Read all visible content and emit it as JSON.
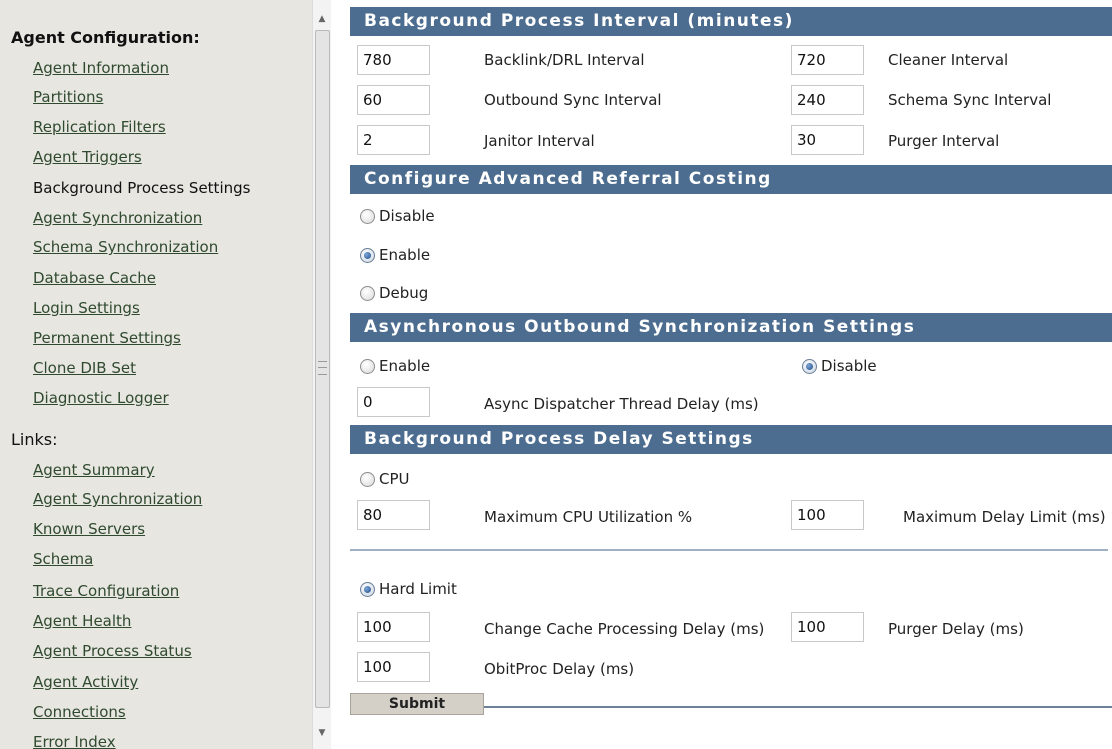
{
  "sidebar": {
    "config_heading": "Agent Configuration:",
    "config_items": [
      {
        "label": "Agent Information"
      },
      {
        "label": "Partitions"
      },
      {
        "label": "Replication Filters"
      },
      {
        "label": "Agent Triggers"
      },
      {
        "label": "Background Process Settings",
        "active": true
      },
      {
        "label": "Agent Synchronization"
      },
      {
        "label": "Schema Synchronization"
      },
      {
        "label": "Database Cache"
      },
      {
        "label": "Login Settings"
      },
      {
        "label": "Permanent Settings"
      },
      {
        "label": "Clone DIB Set"
      },
      {
        "label": "Diagnostic Logger"
      }
    ],
    "links_heading": "Links:",
    "link_items": [
      {
        "label": "Agent Summary"
      },
      {
        "label": "Agent Synchronization"
      },
      {
        "label": "Known Servers"
      },
      {
        "label": "Schema"
      },
      {
        "label": "Trace Configuration"
      },
      {
        "label": "Agent Health"
      },
      {
        "label": "Agent Process Status"
      },
      {
        "label": "Agent Activity"
      },
      {
        "label": "Connections"
      },
      {
        "label": "Error Index"
      }
    ]
  },
  "intervals": {
    "title": "Background Process Interval (minutes)",
    "backlink": {
      "value": "780",
      "label": "Backlink/DRL Interval"
    },
    "cleaner": {
      "value": "720",
      "label": "Cleaner Interval"
    },
    "outbound": {
      "value": "60",
      "label": "Outbound Sync Interval"
    },
    "schema": {
      "value": "240",
      "label": "Schema Sync Interval"
    },
    "janitor": {
      "value": "2",
      "label": "Janitor Interval"
    },
    "purger": {
      "value": "30",
      "label": "Purger Interval"
    }
  },
  "referral": {
    "title": "Configure Advanced Referral Costing",
    "options": {
      "disable": "Disable",
      "enable": "Enable",
      "debug": "Debug"
    },
    "selected": "Enable"
  },
  "async": {
    "title": "Asynchronous Outbound Synchronization Settings",
    "options": {
      "enable": "Enable",
      "disable": "Disable"
    },
    "selected": "Disable",
    "delay": {
      "value": "0",
      "label": "Async Dispatcher Thread Delay (ms)"
    }
  },
  "delay": {
    "title": "Background Process Delay Settings",
    "cpu_label": "CPU",
    "max_cpu": {
      "value": "80",
      "label": "Maximum CPU Utilization %"
    },
    "max_delay": {
      "value": "100",
      "label": "Maximum Delay Limit (ms)"
    },
    "hard_limit_label": "Hard Limit",
    "selected": "Hard Limit",
    "change_cache": {
      "value": "100",
      "label": "Change Cache Processing Delay (ms)"
    },
    "purger_delay": {
      "value": "100",
      "label": "Purger Delay (ms)"
    },
    "obitproc": {
      "value": "100",
      "label": "ObitProc Delay (ms)"
    }
  },
  "submit_label": "Submit"
}
